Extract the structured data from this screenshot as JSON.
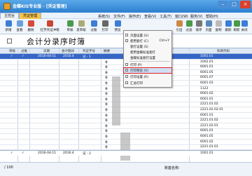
{
  "window": {
    "title": "金蝶KIS专业版 - [凭证管理]",
    "minimize": "–",
    "maximize": "□",
    "close": "×"
  },
  "tabs": [
    {
      "label": "主控台"
    },
    {
      "label": "凭证管理"
    }
  ],
  "menu": [
    "系统(S)",
    "文件(F)",
    "操作(E)",
    "查看(V)",
    "工具(T)",
    "窗口(W)",
    "服务(V)",
    "帮助(H)"
  ],
  "toolbar": [
    {
      "label": "新增",
      "color": "#3b7dd8"
    },
    {
      "label": "查看",
      "color": "#6aa0e0"
    },
    {
      "label": "删除",
      "color": "#d84b3b"
    },
    {
      "label": "红字凭证冲销",
      "color": "#c43"
    },
    {
      "label": "审核",
      "color": "#4a9a4a"
    },
    {
      "label": "反审核",
      "color": "#aa7"
    },
    {
      "label": "过账",
      "color": "#3b7dd8"
    },
    {
      "label": "打印",
      "color": "#666"
    },
    {
      "label": "预览",
      "color": "#3b7dd8"
    },
    {
      "label": "引出",
      "color": "#c84"
    },
    {
      "label": "过滤",
      "color": "#4a9a4a"
    },
    {
      "label": "排序",
      "color": "#777"
    },
    {
      "label": "页面",
      "color": "#58b"
    },
    {
      "label": "复制",
      "color": "#bbb"
    },
    {
      "label": "跟踪",
      "color": "#3b7dd8"
    },
    {
      "label": "刷新",
      "color": "#4a9a4a"
    },
    {
      "label": "设置",
      "color": "#888"
    },
    {
      "label": "关闭",
      "color": "#3b7dd8"
    }
  ],
  "doc_title": "会计分录序时簿",
  "grid": {
    "headers": [
      "审核",
      "过账",
      "日期",
      "会计期间",
      "凭证字号",
      "摘要",
      "科目代码"
    ],
    "first_row": {
      "mark1": "✓",
      "mark2": "✓",
      "date": "2016-04-11",
      "period": "2016.4",
      "voucher": "记 - 1",
      "summary": "",
      "code": "1001.01"
    },
    "codes": [
      "1001.01",
      "1002.01",
      "6001.01",
      "6001.05",
      "6001.07",
      "6001.03",
      "1122",
      "6001.02",
      "6001.01",
      "2221.01.02",
      "2221.02.02.01",
      "6001.01",
      "2221.01.02",
      "2221.02.01",
      "6001.01",
      "6001.05",
      "6001.02",
      "2221.01.01",
      "6001.06"
    ],
    "summaries": [
      "",
      "补",
      "补",
      "补",
      "补",
      "补",
      "补",
      "补",
      "补",
      "补",
      "补",
      "补",
      "补",
      "补",
      "补",
      "补",
      "补",
      "补",
      "补"
    ],
    "last_row": {
      "mark1": "✓",
      "mark2": "✓",
      "date": "2016-04-11",
      "period": "2016.4",
      "voucher": "记 - 2",
      "code": "1001.01"
    }
  },
  "dropdown": [
    {
      "text": "页面设置 (U)",
      "key": ""
    },
    {
      "text": "使用套打 (C)",
      "key": "Ctrl+Y"
    },
    {
      "text": "套打设置 (S)",
      "key": ""
    },
    {
      "text": "使用金蝶标准套打",
      "key": ""
    },
    {
      "text": "金蝶标准套打设置",
      "key": ""
    },
    {
      "text": "打印 (P)",
      "key": ""
    },
    {
      "text": "打印预览 (V)",
      "key": "",
      "highlight": true
    },
    {
      "text": "打印设置 (R)",
      "key": ""
    },
    {
      "text": "汇总打印",
      "key": ""
    }
  ],
  "status": {
    "left": "/ 100",
    "mid": "账套名称:"
  }
}
